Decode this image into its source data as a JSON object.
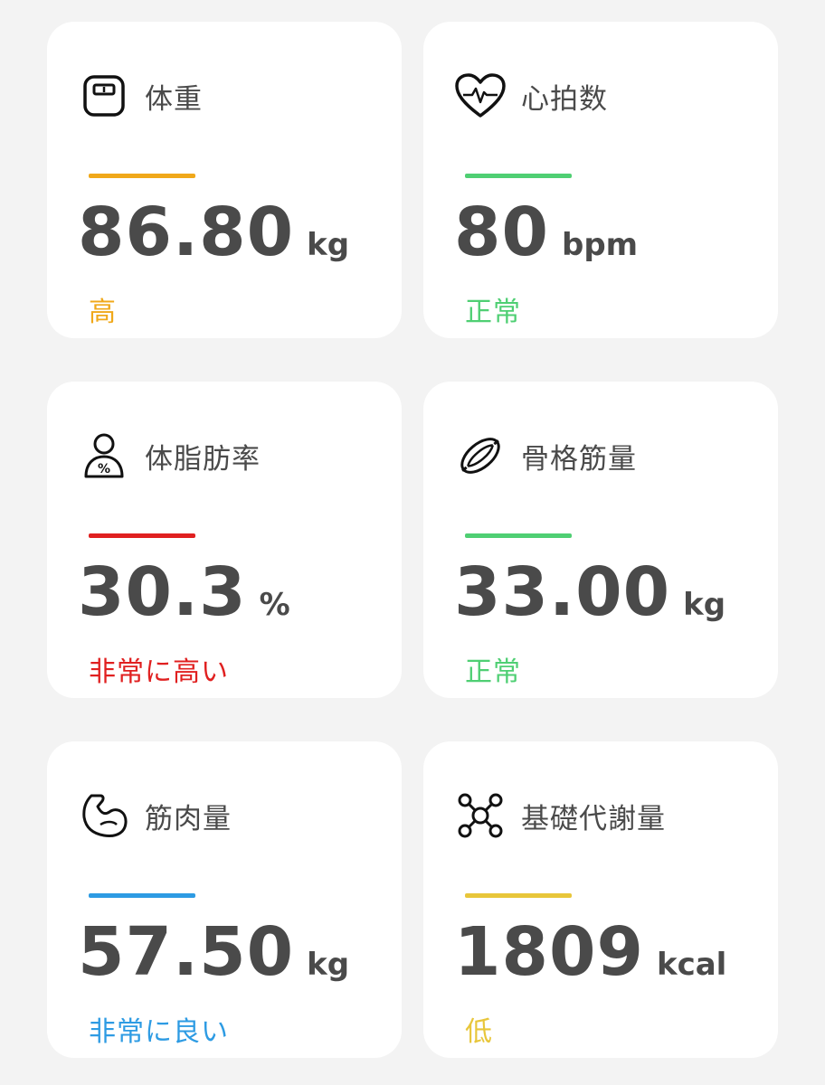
{
  "metrics": [
    {
      "icon": "scale-icon",
      "label": "体重",
      "value": "86.80",
      "unit": "kg",
      "status": "高",
      "color": "#f0a81a"
    },
    {
      "icon": "heart-rate-icon",
      "label": "心拍数",
      "value": "80",
      "unit": "bpm",
      "status": "正常",
      "color": "#4fcf73"
    },
    {
      "icon": "body-fat-icon",
      "label": "体脂肪率",
      "value": "30.3",
      "unit": "%",
      "status": "非常に高い",
      "color": "#e02020"
    },
    {
      "icon": "skeletal-muscle-icon",
      "label": "骨格筋量",
      "value": "33.00",
      "unit": "kg",
      "status": "正常",
      "color": "#4fcf73"
    },
    {
      "icon": "muscle-arm-icon",
      "label": "筋肉量",
      "value": "57.50",
      "unit": "kg",
      "status": "非常に良い",
      "color": "#2d9be3"
    },
    {
      "icon": "metabolism-icon",
      "label": "基礎代謝量",
      "value": "1809",
      "unit": "kcal",
      "status": "低",
      "color": "#e8c63a"
    }
  ]
}
